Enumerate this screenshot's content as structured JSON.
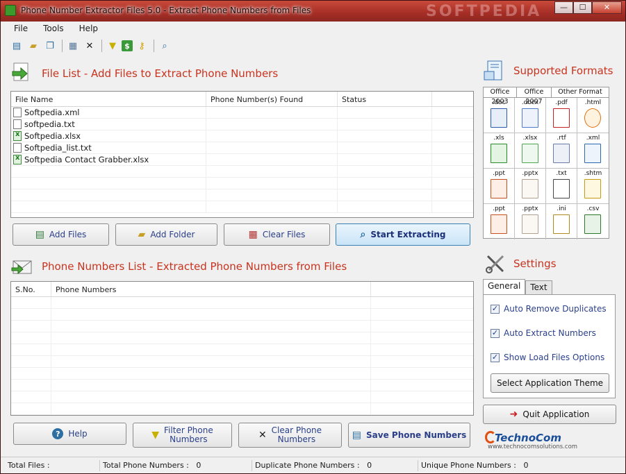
{
  "window": {
    "title": "Phone Number Extractor Files 5.0 - Extract Phone Numbers from Files",
    "watermark": "SOFTPEDIA",
    "minimize": "—",
    "maximize": "☐",
    "close": "✕"
  },
  "menu": [
    "File",
    "Tools",
    "Help"
  ],
  "filelist": {
    "title": "File List - Add Files to Extract Phone Numbers",
    "columns": [
      "File Name",
      "Phone Number(s) Found",
      "Status"
    ],
    "rows": [
      {
        "name": "Softpedia.xml",
        "type": "doc",
        "found": "",
        "status": ""
      },
      {
        "name": "softpedia.txt",
        "type": "doc",
        "found": "",
        "status": ""
      },
      {
        "name": "Softpedia.xlsx",
        "type": "xl",
        "found": "",
        "status": ""
      },
      {
        "name": "Softpedia_list.txt",
        "type": "doc",
        "found": "",
        "status": ""
      },
      {
        "name": "Softpedia Contact Grabber.xlsx",
        "type": "xl",
        "found": "",
        "status": ""
      }
    ]
  },
  "buttons": {
    "add_files": "Add Files",
    "add_folder": "Add Folder",
    "clear_files": "Clear Files",
    "start_extracting": "Start Extracting",
    "help": "Help",
    "filter_phone_1": "Filter Phone",
    "filter_phone_2": "Numbers",
    "clear_phone_1": "Clear Phone",
    "clear_phone_2": "Numbers",
    "save_phone": "Save Phone Numbers",
    "quit": "Quit Application",
    "select_theme": "Select Application Theme"
  },
  "phonelist": {
    "title": "Phone Numbers List - Extracted Phone Numbers from Files",
    "columns": [
      "S.No.",
      "Phone Numbers"
    ]
  },
  "formats": {
    "title": "Supported Formats",
    "headers": [
      "Office 2003",
      "Office 2007",
      "Other Format"
    ],
    "rows": [
      [
        ".doc",
        ".docx",
        ".pdf",
        ".html"
      ],
      [
        ".xls",
        ".xlsx",
        ".rtf",
        ".xml"
      ],
      [
        ".ppt",
        ".pptx",
        ".txt",
        ".shtm"
      ],
      [
        ".ppt",
        ".pptx",
        ".ini",
        ".csv"
      ]
    ]
  },
  "settings": {
    "title": "Settings",
    "tabs": [
      "General",
      "Text"
    ],
    "options": [
      {
        "label": "Auto Remove Duplicates",
        "checked": true
      },
      {
        "label": "Auto Extract Numbers",
        "checked": true
      },
      {
        "label": "Show Load Files Options",
        "checked": true
      }
    ]
  },
  "logo": {
    "brand": "TechnoCom",
    "url": "www.technocomsolutions.com"
  },
  "status": {
    "total_files_label": "Total Files :",
    "total_files": "",
    "total_phone_label": "Total Phone Numbers :",
    "total_phone": "0",
    "dup_label": "Duplicate Phone Numbers :",
    "dup": "0",
    "unique_label": "Unique Phone Numbers :",
    "unique": "0"
  },
  "colors": {
    "accent_title": "#c8331e",
    "button_text": "#2a3f8a"
  }
}
